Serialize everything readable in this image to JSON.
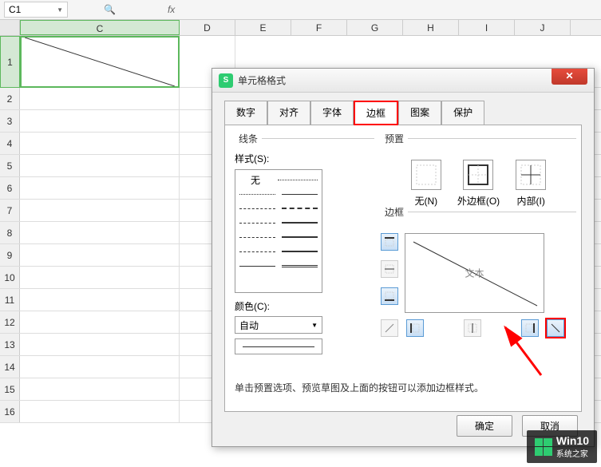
{
  "toolbar": {
    "name_box_value": "C1"
  },
  "columns": [
    "C",
    "D",
    "E",
    "F",
    "G",
    "H",
    "I",
    "J"
  ],
  "rows": [
    "1",
    "2",
    "3",
    "4",
    "5",
    "6",
    "7",
    "8",
    "9",
    "10",
    "11",
    "12",
    "13",
    "14",
    "15",
    "16"
  ],
  "dialog": {
    "title": "单元格格式",
    "tabs": {
      "number": "数字",
      "align": "对齐",
      "font": "字体",
      "border": "边框",
      "pattern": "图案",
      "protect": "保护"
    },
    "line_section": {
      "legend": "线条",
      "style_label": "样式(S):",
      "none_label": "无",
      "color_label": "颜色(C):",
      "color_value": "自动"
    },
    "preset_section": {
      "legend": "预置",
      "none": "无(N)",
      "outline": "外边框(O)",
      "inside": "内部(I)"
    },
    "border_section": {
      "legend": "边框",
      "preview_text": "文本"
    },
    "hint": "单击预置选项、预览草图及上面的按钮可以添加边框样式。",
    "ok": "确定",
    "cancel": "取消"
  },
  "watermark": {
    "line1": "Win10",
    "line2": "系统之家"
  }
}
